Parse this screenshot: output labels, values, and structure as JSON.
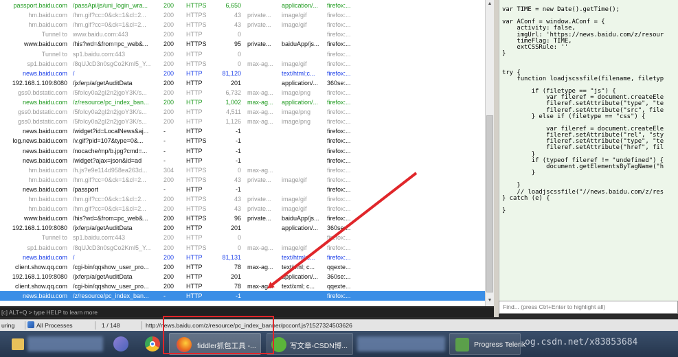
{
  "sessions": [
    {
      "host": "passport.baidu.com",
      "url": "/passApi/js/uni_login_wra...",
      "result": "200",
      "protocol": "HTTPS",
      "body": "6,650",
      "caching": "",
      "content_type": "application/...",
      "process": "firefox:...",
      "color": "green"
    },
    {
      "host": "hm.baidu.com",
      "url": "/hm.gif?cc=0&ck=1&cl=2...",
      "result": "200",
      "protocol": "HTTPS",
      "body": "43",
      "caching": "private...",
      "content_type": "image/gif",
      "process": "firefox:...",
      "color": "gray"
    },
    {
      "host": "hm.baidu.com",
      "url": "/hm.gif?cc=0&ck=1&cl=2...",
      "result": "200",
      "protocol": "HTTPS",
      "body": "43",
      "caching": "private...",
      "content_type": "image/gif",
      "process": "firefox:...",
      "color": "gray"
    },
    {
      "host": "Tunnel to",
      "url": "www.baidu.com:443",
      "result": "200",
      "protocol": "HTTP",
      "body": "0",
      "caching": "",
      "content_type": "",
      "process": "firefox:...",
      "color": "gray"
    },
    {
      "host": "www.baidu.com",
      "url": "/his?wd=&from=pc_web&...",
      "result": "200",
      "protocol": "HTTPS",
      "body": "95",
      "caching": "private...",
      "content_type": "baiduApp/js...",
      "process": "firefox:...",
      "color": "black"
    },
    {
      "host": "Tunnel to",
      "url": "sp1.baidu.com:443",
      "result": "200",
      "protocol": "HTTP",
      "body": "0",
      "caching": "",
      "content_type": "",
      "process": "firefox:...",
      "color": "gray"
    },
    {
      "host": "sp1.baidu.com",
      "url": "/8qUJcD3n0sgCo2Kml5_Y...",
      "result": "200",
      "protocol": "HTTPS",
      "body": "0",
      "caching": "max-ag...",
      "content_type": "image/gif",
      "process": "firefox:...",
      "color": "gray"
    },
    {
      "host": "news.baidu.com",
      "url": "/",
      "result": "200",
      "protocol": "HTTP",
      "body": "81,120",
      "caching": "",
      "content_type": "text/html;c...",
      "process": "firefox:...",
      "color": "blue"
    },
    {
      "host": "192.168.1.109:8080",
      "url": "/jxferp/a/getAuditData",
      "result": "200",
      "protocol": "HTTP",
      "body": "201",
      "caching": "",
      "content_type": "application/...",
      "process": "360se:...",
      "color": "black"
    },
    {
      "host": "gss0.bdstatic.com",
      "url": "/5foIcy0a2gI2n2jgoY3K/s...",
      "result": "200",
      "protocol": "HTTP",
      "body": "6,732",
      "caching": "max-ag...",
      "content_type": "image/png",
      "process": "firefox:...",
      "color": "gray"
    },
    {
      "host": "news.baidu.com",
      "url": "/z/resource/pc_index_ban...",
      "result": "200",
      "protocol": "HTTP",
      "body": "1,002",
      "caching": "max-ag...",
      "content_type": "application/...",
      "process": "firefox:...",
      "color": "green"
    },
    {
      "host": "gss0.bdstatic.com",
      "url": "/5foIcy0a2gI2n2jgoY3K/s...",
      "result": "200",
      "protocol": "HTTP",
      "body": "4,511",
      "caching": "max-ag...",
      "content_type": "image/png",
      "process": "firefox:...",
      "color": "gray"
    },
    {
      "host": "gss0.bdstatic.com",
      "url": "/5foIcy0a2gI2n2jgoY3K/s...",
      "result": "200",
      "protocol": "HTTP",
      "body": "1,126",
      "caching": "max-ag...",
      "content_type": "image/png",
      "process": "firefox:...",
      "color": "gray"
    },
    {
      "host": "news.baidu.com",
      "url": "/widget?id=LocalNews&aj...",
      "result": "-",
      "protocol": "HTTP",
      "body": "-1",
      "caching": "",
      "content_type": "",
      "process": "firefox:...",
      "color": "black"
    },
    {
      "host": "log.news.baidu.com",
      "url": "/v.gif?pid=107&type=0&...",
      "result": "-",
      "protocol": "HTTPS",
      "body": "-1",
      "caching": "",
      "content_type": "",
      "process": "firefox:...",
      "color": "black"
    },
    {
      "host": "news.baidu.com",
      "url": "/nocache/mp/b.jpg?cmd=...",
      "result": "-",
      "protocol": "HTTP",
      "body": "-1",
      "caching": "",
      "content_type": "",
      "process": "firefox:...",
      "color": "black"
    },
    {
      "host": "news.baidu.com",
      "url": "/widget?ajax=json&id=ad",
      "result": "-",
      "protocol": "HTTP",
      "body": "-1",
      "caching": "",
      "content_type": "",
      "process": "firefox:...",
      "color": "black"
    },
    {
      "host": "hm.baidu.com",
      "url": "/h.js?e9e114d958ea263d...",
      "result": "304",
      "protocol": "HTTPS",
      "body": "0",
      "caching": "max-ag...",
      "content_type": "",
      "process": "firefox:...",
      "color": "gray"
    },
    {
      "host": "hm.baidu.com",
      "url": "/hm.gif?cc=0&ck=1&cl=2...",
      "result": "200",
      "protocol": "HTTPS",
      "body": "43",
      "caching": "private...",
      "content_type": "image/gif",
      "process": "firefox:...",
      "color": "gray"
    },
    {
      "host": "news.baidu.com",
      "url": "/passport",
      "result": "-",
      "protocol": "HTTP",
      "body": "-1",
      "caching": "",
      "content_type": "",
      "process": "firefox:...",
      "color": "black"
    },
    {
      "host": "hm.baidu.com",
      "url": "/hm.gif?cc=0&ck=1&cl=2...",
      "result": "200",
      "protocol": "HTTPS",
      "body": "43",
      "caching": "private...",
      "content_type": "image/gif",
      "process": "firefox:...",
      "color": "gray"
    },
    {
      "host": "hm.baidu.com",
      "url": "/hm.gif?cc=0&ck=1&cl=2...",
      "result": "200",
      "protocol": "HTTPS",
      "body": "43",
      "caching": "private...",
      "content_type": "image/gif",
      "process": "firefox:...",
      "color": "gray"
    },
    {
      "host": "www.baidu.com",
      "url": "/his?wd=&from=pc_web&...",
      "result": "200",
      "protocol": "HTTPS",
      "body": "96",
      "caching": "private...",
      "content_type": "baiduApp/js...",
      "process": "firefox:...",
      "color": "black"
    },
    {
      "host": "192.168.1.109:8080",
      "url": "/jxferp/a/getAuditData",
      "result": "200",
      "protocol": "HTTP",
      "body": "201",
      "caching": "",
      "content_type": "application/...",
      "process": "360se:...",
      "color": "black"
    },
    {
      "host": "Tunnel to",
      "url": "sp1.baidu.com:443",
      "result": "200",
      "protocol": "HTTP",
      "body": "0",
      "caching": "",
      "content_type": "",
      "process": "firefox:...",
      "color": "gray"
    },
    {
      "host": "sp1.baidu.com",
      "url": "/8qUJcD3n0sgCo2Kml5_Y...",
      "result": "200",
      "protocol": "HTTPS",
      "body": "0",
      "caching": "max-ag...",
      "content_type": "image/gif",
      "process": "firefox:...",
      "color": "gray"
    },
    {
      "host": "news.baidu.com",
      "url": "/",
      "result": "200",
      "protocol": "HTTP",
      "body": "81,131",
      "caching": "",
      "content_type": "text/html;c...",
      "process": "firefox:...",
      "color": "blue"
    },
    {
      "host": "client.show.qq.com",
      "url": "/cgi-bin/qqshow_user_pro...",
      "result": "200",
      "protocol": "HTTP",
      "body": "78",
      "caching": "max-ag...",
      "content_type": "text/xml; c...",
      "process": "qqexte...",
      "color": "black"
    },
    {
      "host": "192.168.1.109:8080",
      "url": "/jxferp/a/getAuditData",
      "result": "200",
      "protocol": "HTTP",
      "body": "201",
      "caching": "",
      "content_type": "application/...",
      "process": "360se:...",
      "color": "black"
    },
    {
      "host": "client.show.qq.com",
      "url": "/cgi-bin/qqshow_user_pro...",
      "result": "200",
      "protocol": "HTTP",
      "body": "78",
      "caching": "max-ag...",
      "content_type": "text/xml; c...",
      "process": "qqexte...",
      "color": "black"
    },
    {
      "host": "news.baidu.com",
      "url": "/z/resource/pc_index_ban...",
      "result": "-",
      "protocol": "HTTP",
      "body": "-1",
      "caching": "",
      "content_type": "",
      "process": "firefox:...",
      "color": "selected"
    }
  ],
  "code_lines": [
    "var TIME = new Date().getTime();",
    "",
    "var AConf = window.AConf = {",
    "    activity: false,",
    "    imgUrl: 'https://news.baidu.com/z/resour",
    "    timeFlag: TIME,",
    "    extCSSRule: ''",
    "}",
    "",
    "",
    "try {",
    "    function loadjscssfile(filename, filetyp",
    "",
    "        if (filetype == \"js\") {",
    "            var fileref = document.createEle",
    "            fileref.setAttribute(\"type\", \"te",
    "            fileref.setAttribute(\"src\", file",
    "        } else if (filetype == \"css\") {",
    "",
    "            var fileref = document.createEle",
    "            fileref.setAttribute(\"rel\", \"sty",
    "            fileref.setAttribute(\"type\", \"te",
    "            fileref.setAttribute(\"href\", fil",
    "        }",
    "        if (typeof fileref != \"undefined\") {",
    "            document.getElementsByTagName(\"h",
    "        }",
    "",
    "    }",
    "    // loadjscssfile(\"//news.baidu.com/z/res",
    "} catch (e) {",
    "",
    "}"
  ],
  "find_placeholder": "Find... (press Ctrl+Enter to highlight all)",
  "quickexec": "[c] ALT+Q > type HELP to learn more",
  "status": {
    "capturing": "uring",
    "process_filter": "All Processes",
    "count": "1 / 148",
    "url": "http://news.baidu.com/z/resource/pc_index_banner/pcconf.js?1527324503626"
  },
  "taskbar": {
    "fiddler_label": "fiddler抓包工具 -...",
    "csdn_label": "写文章-CSDN博...",
    "telerik_label": "Progress Telerik",
    "watermark": "og.csdn.net/x83853684"
  },
  "colors": {
    "green": "#1e9a1e",
    "gray": "#9a9a9a",
    "black": "#111111",
    "blue": "#1a3ee8",
    "selected_bg": "#3b8ee6",
    "annotation_red": "#e0262a"
  }
}
